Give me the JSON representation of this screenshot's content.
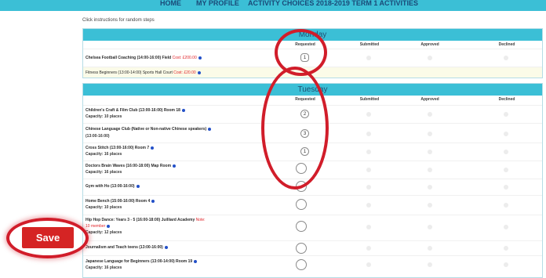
{
  "nav": {
    "items": [
      "HOME",
      "MY PROFILE",
      "ACTIVITY CHOICES 2018-2019 TERM 1 ACTIVITIES"
    ]
  },
  "instructions": "Click instructions for random steps",
  "columns": [
    "Requested",
    "Submitted",
    "Approved",
    "Declined"
  ],
  "monday": {
    "title": "Monday",
    "rows": [
      {
        "activity": "Chelsea Football Coaching (14:00-16:00) Field",
        "note": "Cost: £200.00",
        "requested": "1"
      },
      {
        "activity": "Fitness Beginners (13:00-14:00) Sports Hall Court",
        "note": "Cost: £20.00",
        "requested": ""
      }
    ]
  },
  "tuesday": {
    "title": "Tuesday",
    "rows": [
      {
        "activity": "Children's Craft & Film Club (13:00-16:00) Room 18",
        "capacity": "Capacity: 10 places",
        "requested": "2"
      },
      {
        "activity": "Chinese Language Club (Native or Non-native Chinese speakers)",
        "activity2": "(13:00-16:00)",
        "requested": "3"
      },
      {
        "activity": "Cross Stitch (13:00-16:00) Room 7",
        "capacity": "Capacity: 16 places",
        "requested": "1"
      },
      {
        "activity": "Doctors Brain Waves (16:00-18:00) Map Room",
        "capacity": "Capacity: 16 places",
        "requested": ""
      },
      {
        "activity": "Gym with Ho (13:00-16:00)",
        "requested": ""
      },
      {
        "activity": "Home Bench (15:00-16:00) Room 4",
        "capacity": "Capacity: 10 places",
        "requested": ""
      },
      {
        "activity": "Hip Hop Dance: Years 3 - 5 (16:00-18:00) Juilliard Academy",
        "note": "Note:",
        "note2": "10 member",
        "capacity": "Capacity: 12 places",
        "requested": ""
      },
      {
        "activity": "Journalism and Teach teens (13:00-16:00)",
        "requested": ""
      },
      {
        "activity": "Japanese Language for Beginners (13:00-14:00) Room 19",
        "capacity": "Capacity: 16 places",
        "requested": ""
      }
    ]
  },
  "save_label": "Save",
  "colors": {
    "header": "#3bbfd6",
    "annotation": "#d11d2a",
    "save": "#d52424"
  }
}
